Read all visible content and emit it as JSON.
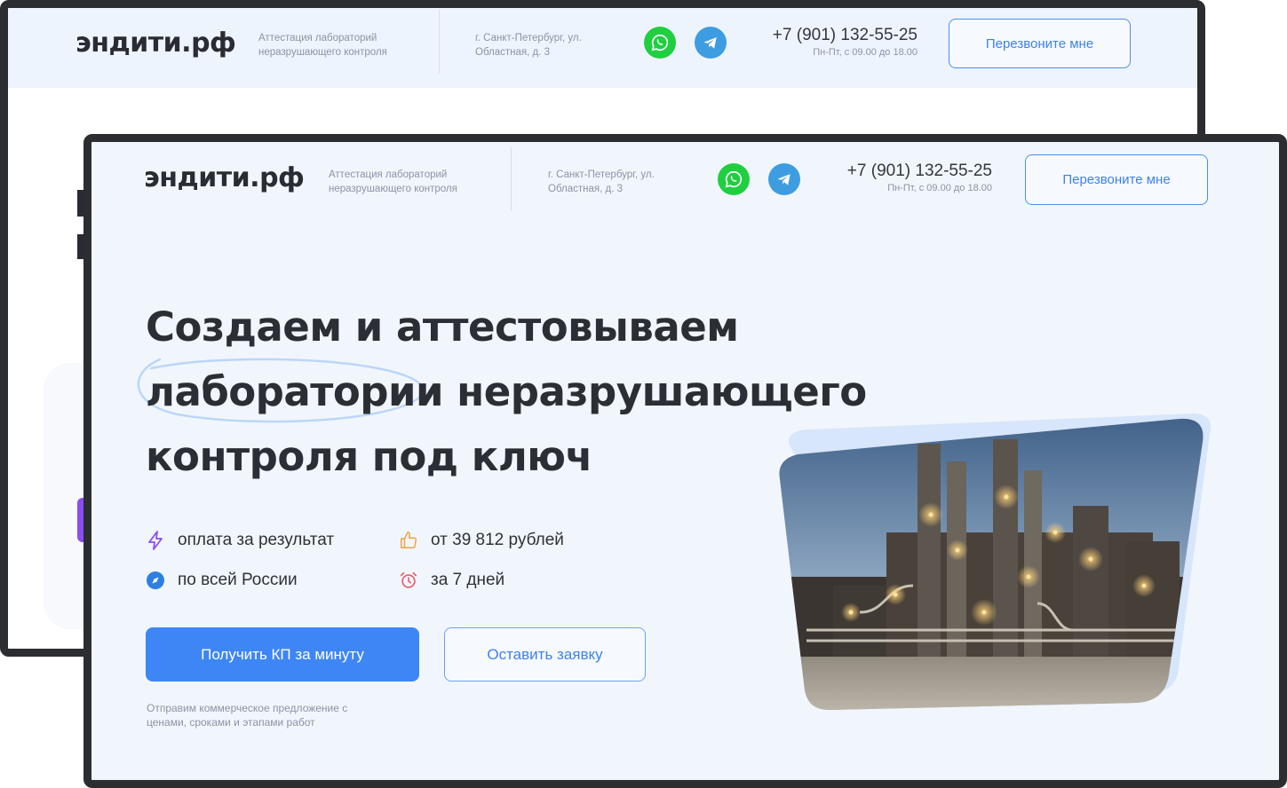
{
  "back_window": {
    "header": {
      "logo": "эндити.рф",
      "tagline": "Аттестация лабораторий неразрушающего контроля",
      "address": "г. Санкт-Петербург, ул. Областная, д. 3",
      "phone": "+7 (901) 132-55-25",
      "hours": "Пн-Пт, с 09.00 до 18.00",
      "callback_label": "Перезвоните мне"
    }
  },
  "front_window": {
    "header": {
      "logo": "эндити.рф",
      "tagline": "Аттестация лабораторий неразрушающего контроля",
      "address": "г. Санкт-Петербург, ул. Областная, д. 3",
      "phone": "+7 (901) 132-55-25",
      "hours": "Пн-Пт, с 09.00 до 18.00",
      "callback_label": "Перезвоните мне"
    },
    "hero": {
      "title_line1": "Создаем и аттестовываем",
      "title_highlight": "лаборатории",
      "title_line2_rest": " неразрушающего",
      "title_line3": "контроля под ключ",
      "features": [
        {
          "icon": "lightning-icon",
          "label": "оплата за результат"
        },
        {
          "icon": "thumbs-up-icon",
          "label": "от 39 812 рублей"
        },
        {
          "icon": "compass-icon",
          "label": "по всей России"
        },
        {
          "icon": "alarm-clock-icon",
          "label": "за 7 дней"
        }
      ],
      "primary_button": "Получить КП за минуту",
      "secondary_button": "Оставить заявку",
      "note": "Отправим коммерческое предложение с ценами, сроками и этапами работ"
    },
    "colors": {
      "accent": "#3e86f5",
      "whatsapp": "#1fcf3f",
      "telegram": "#3d9de0",
      "lightning": "#8b4df0",
      "thumbs": "#f0a23c",
      "compass": "#2f7fe0",
      "alarm": "#ec5a6a"
    }
  }
}
